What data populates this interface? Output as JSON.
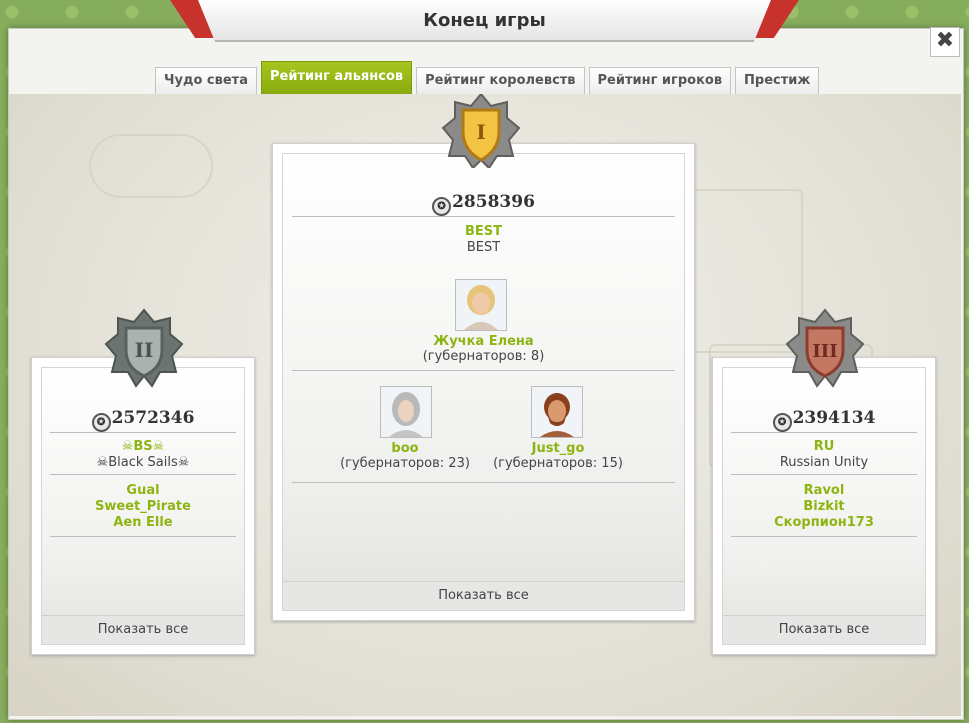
{
  "window": {
    "title": "Конец игры",
    "close_label": "✖"
  },
  "tabs": [
    {
      "label": "Чудо света",
      "active": false
    },
    {
      "label": "Рейтинг альянсов",
      "active": true
    },
    {
      "label": "Рейтинг королевств",
      "active": false
    },
    {
      "label": "Рейтинг игроков",
      "active": false
    },
    {
      "label": "Престиж",
      "active": false
    }
  ],
  "first": {
    "rank": "I",
    "score": "2858396",
    "tag": "BEST",
    "name": "BEST",
    "leader": {
      "name": "Жучка Елена",
      "governors": "(губернаторов: 8)"
    },
    "members": [
      {
        "name": "boo",
        "governors": "(губернаторов: 23)"
      },
      {
        "name": "Just_go",
        "governors": "(губернаторов: 15)"
      }
    ],
    "show_all": "Показать все"
  },
  "second": {
    "rank": "II",
    "score": "2572346",
    "tag": "☠BS☠",
    "name": "☠Black Sails☠",
    "members": [
      "Gual",
      "Sweet_Pirate",
      "Aen Elle"
    ],
    "show_all": "Показать все"
  },
  "third": {
    "rank": "III",
    "score": "2394134",
    "tag": "RU",
    "name": "Russian Unity",
    "members": [
      "Ravol",
      "Bizkit",
      "Скорпион173"
    ],
    "show_all": "Показать все"
  },
  "colors": {
    "accent": "#8db511",
    "ribbon": "#c8322d",
    "gold": "#e3a92a",
    "silver": "#8d9692",
    "bronze": "#b5624e"
  }
}
